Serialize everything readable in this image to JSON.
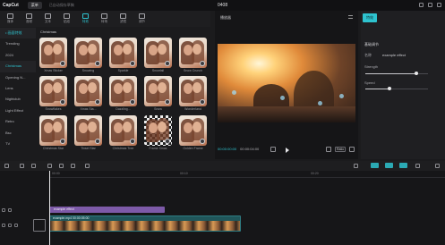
{
  "app": {
    "logo": "CapCut",
    "menu_label": "菜单",
    "autosave": "已自动保存草稿",
    "project_name": "0408"
  },
  "toolbar": {
    "items": [
      {
        "label": "媒体",
        "icon": "media-icon"
      },
      {
        "label": "音频",
        "icon": "audio-icon"
      },
      {
        "label": "文本",
        "icon": "text-icon"
      },
      {
        "label": "贴纸",
        "icon": "sticker-icon"
      },
      {
        "label": "特效",
        "icon": "effects-icon",
        "active": true
      },
      {
        "label": "转场",
        "icon": "transition-icon"
      },
      {
        "label": "滤镜",
        "icon": "filter-icon"
      },
      {
        "label": "调节",
        "icon": "adjust-icon"
      }
    ]
  },
  "categories": [
    {
      "label": "• 画面特效",
      "active": true
    },
    {
      "label": "Trending"
    },
    {
      "label": "2024"
    },
    {
      "label": "Christmas"
    },
    {
      "label": "Opening N..."
    },
    {
      "label": "Lens"
    },
    {
      "label": "Nightclub"
    },
    {
      "label": "Light Effect"
    },
    {
      "label": "Retro"
    },
    {
      "label": "Bsc"
    },
    {
      "label": "TV"
    }
  ],
  "grid": {
    "section_title": "Christmas",
    "items": [
      {
        "label": "Xmas Sticker"
      },
      {
        "label": "Snowing"
      },
      {
        "label": "Sparkle"
      },
      {
        "label": "Snowfall"
      },
      {
        "label": "Snow Crunch"
      },
      {
        "label": "Snowflakes"
      },
      {
        "label": "Xmas Sta..."
      },
      {
        "label": "Dazzling..."
      },
      {
        "label": "Snow"
      },
      {
        "label": "Wonderland"
      },
      {
        "label": "Christmas Star"
      },
      {
        "label": "Tinsel Star"
      },
      {
        "label": "Christmas Tree"
      },
      {
        "label": "Frame Xmas"
      },
      {
        "label": "Golden Frame"
      }
    ]
  },
  "player": {
    "title": "播放器",
    "time_current": "00:00:00:00",
    "time_total": "00:00:04:00",
    "ratio": "Ratio"
  },
  "details": {
    "tab": "特效",
    "section": "基础调节",
    "effect_label": "名称",
    "effect_value": "example effect",
    "strength_label": "Strength",
    "speed_label": "Speed",
    "strength_value": 0.82,
    "speed_value": 0.38
  },
  "timeline": {
    "ruler_ticks": [
      "00:00",
      "00:10",
      "00:20"
    ],
    "effect_clip_label": "example effect",
    "video_clip_label": "example.mp4  00:00:05:00"
  },
  "colors": {
    "accent": "#2ec3cf",
    "effect_track": "#7d5aa8",
    "video_track": "#20565a"
  }
}
